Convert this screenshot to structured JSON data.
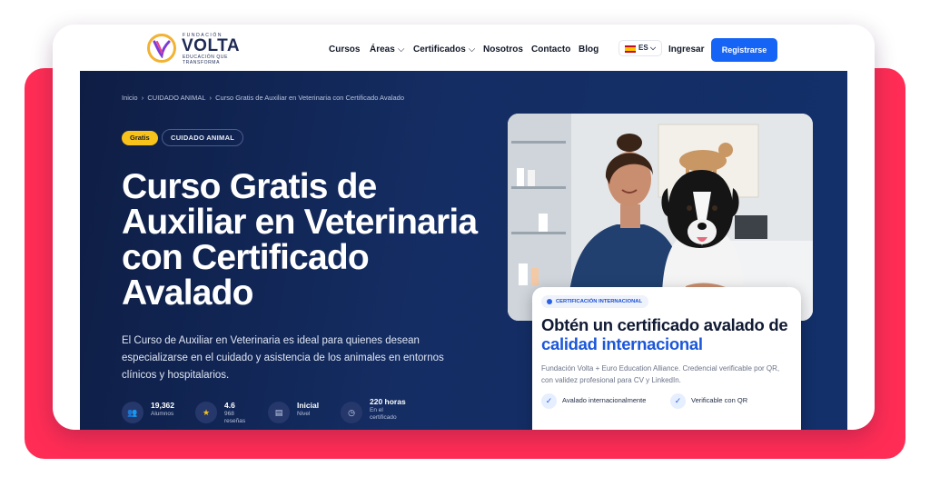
{
  "logo": {
    "top": "FUNDACIÓN",
    "name": "VOLTA",
    "sub": "EDUCACIÓN QUE TRANSFORMA"
  },
  "nav": {
    "items": [
      "Cursos",
      "Áreas",
      "Certificados",
      "Nosotros",
      "Contacto",
      "Blog"
    ],
    "lang": "ES",
    "login": "Ingresar",
    "register": "Registrarse"
  },
  "breadcrumb": {
    "home": "Inicio",
    "sep": "›",
    "category": "CUIDADO ANIMAL",
    "current": "Curso Gratis de Auxiliar en Veterinaria con Certificado Avalado"
  },
  "badges": {
    "free": "Gratis",
    "category": "CUIDADO ANIMAL"
  },
  "hero": {
    "title": "Curso Gratis de Auxiliar en Veterinaria con Certificado Avalado",
    "description": "El Curso de Auxiliar en Veterinaria es ideal para quienes desean especializarse en el cuidado y asistencia de los animales en entornos clínicos y hospitalarios."
  },
  "stats": [
    {
      "value": "19,362",
      "label": "Alumnos"
    },
    {
      "value": "4.6",
      "label": "968 reseñas"
    },
    {
      "value": "Inicial",
      "label": "Nivel"
    },
    {
      "value": "220 horas",
      "label": "En el certificado"
    }
  ],
  "cert": {
    "badge": "CERTIFICACIÓN INTERNACIONAL",
    "title_part1": "Obtén un certificado avalado de",
    "title_highlight": "calidad internacional",
    "description": "Fundación Volta + Euro Education Alliance. Credencial verificable por QR, con validez profesional para CV y LinkedIn.",
    "checks": [
      "Avalado internacionalmente",
      "Verificable con QR"
    ]
  },
  "colors": {
    "accent": "#1664f5",
    "backdrop": "#ff2d55",
    "hero_bg": "#0e1d44",
    "badge_yellow": "#f7c21a"
  }
}
